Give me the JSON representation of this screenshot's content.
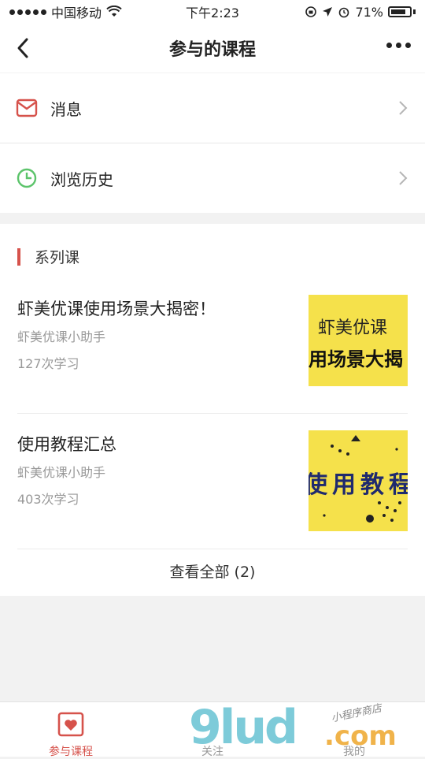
{
  "status_bar": {
    "carrier": "中国移动",
    "time": "下午2:23",
    "battery": "71%"
  },
  "nav": {
    "title": "参与的课程"
  },
  "menu": [
    {
      "label": "消息",
      "icon": "mail-icon"
    },
    {
      "label": "浏览历史",
      "icon": "clock-icon"
    }
  ],
  "series": {
    "title": "系列课",
    "courses": [
      {
        "title": "虾美优课使用场景大揭密！",
        "author": "虾美优课小助手",
        "count": "127次学习",
        "thumb_line1": "虾美优课",
        "thumb_line2": "用场景大揭"
      },
      {
        "title": "使用教程汇总",
        "author": "虾美优课小助手",
        "count": "403次学习",
        "thumb_text": "使用教程"
      }
    ],
    "view_all": "查看全部 (2)"
  },
  "tabs": [
    {
      "label": "参与课程",
      "active": true
    },
    {
      "label": "关注"
    },
    {
      "label": "我的"
    }
  ],
  "watermark": {
    "main": "9lud",
    "suffix": ".com",
    "small": "小程序商店"
  },
  "colors": {
    "accent": "#d6524b",
    "mail": "#d6524b",
    "clock": "#5cc46b",
    "thumb_bg": "#f5e14b"
  }
}
